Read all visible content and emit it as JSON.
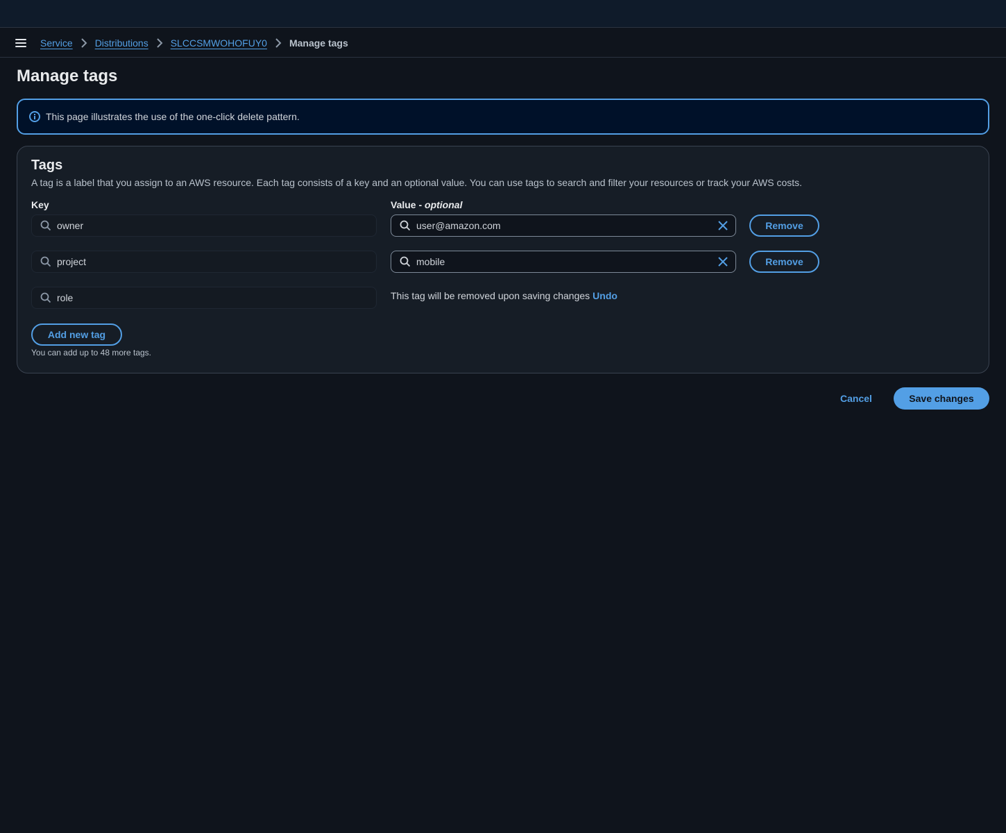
{
  "breadcrumbs": {
    "items": [
      "Service",
      "Distributions",
      "SLCCSMWOHOFUY0"
    ],
    "current": "Manage tags"
  },
  "page": {
    "title": "Manage tags"
  },
  "alert": {
    "text": "This page illustrates the use of the one-click delete pattern."
  },
  "tags": {
    "title": "Tags",
    "description": "A tag is a label that you assign to an AWS resource. Each tag consists of a key and an optional value. You can use tags to search and filter your resources or track your AWS costs.",
    "key_label": "Key",
    "value_label": "Value - ",
    "value_label_optional": "optional",
    "rows": [
      {
        "key": "owner",
        "value": "user@amazon.com",
        "remove_label": "Remove"
      },
      {
        "key": "project",
        "value": "mobile",
        "remove_label": "Remove"
      },
      {
        "key": "role"
      }
    ],
    "removed_message": "This tag will be removed upon saving changes",
    "undo_label": "Undo",
    "add_label": "Add new tag",
    "hint": "You can add up to 48 more tags."
  },
  "actions": {
    "cancel_label": "Cancel",
    "save_label": "Save changes"
  },
  "colors": {
    "accent": "#539fe5",
    "background": "#0f141c",
    "panel": "#161d26"
  }
}
